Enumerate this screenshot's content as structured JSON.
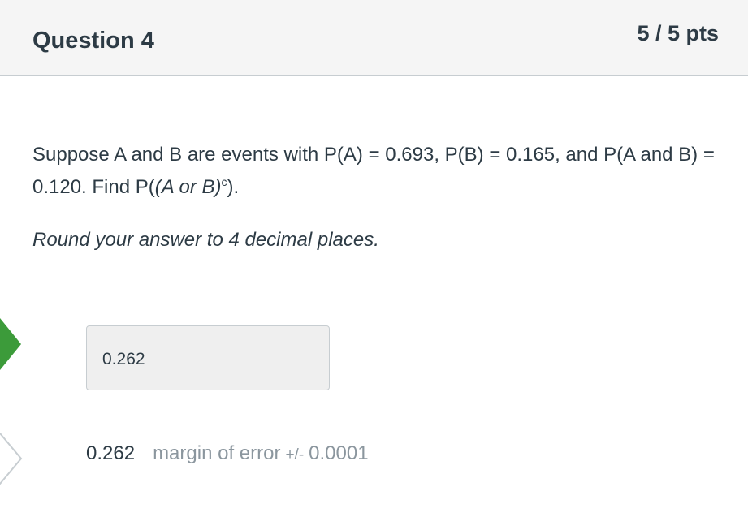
{
  "question": {
    "title": "Question 4",
    "points": "5 / 5 pts",
    "text_part1": "Suppose A and B are events with P(A) = 0.693, P(B) = 0.165, and P(A and B) = 0.120. Find P(",
    "text_italic": "(A or B)",
    "text_sup": "c",
    "text_part2": ").",
    "instruction": "Round your answer to 4 decimal places."
  },
  "answer": {
    "submitted_value": "0.262",
    "status": "correct"
  },
  "expected": {
    "value": "0.262",
    "margin_label": "margin of error",
    "margin_sign": "+/-",
    "margin_value": "0.0001"
  },
  "colors": {
    "correct_marker": "#3c9b3a",
    "expected_marker_fill": "#ffffff",
    "expected_marker_stroke": "#c7cdd1"
  }
}
